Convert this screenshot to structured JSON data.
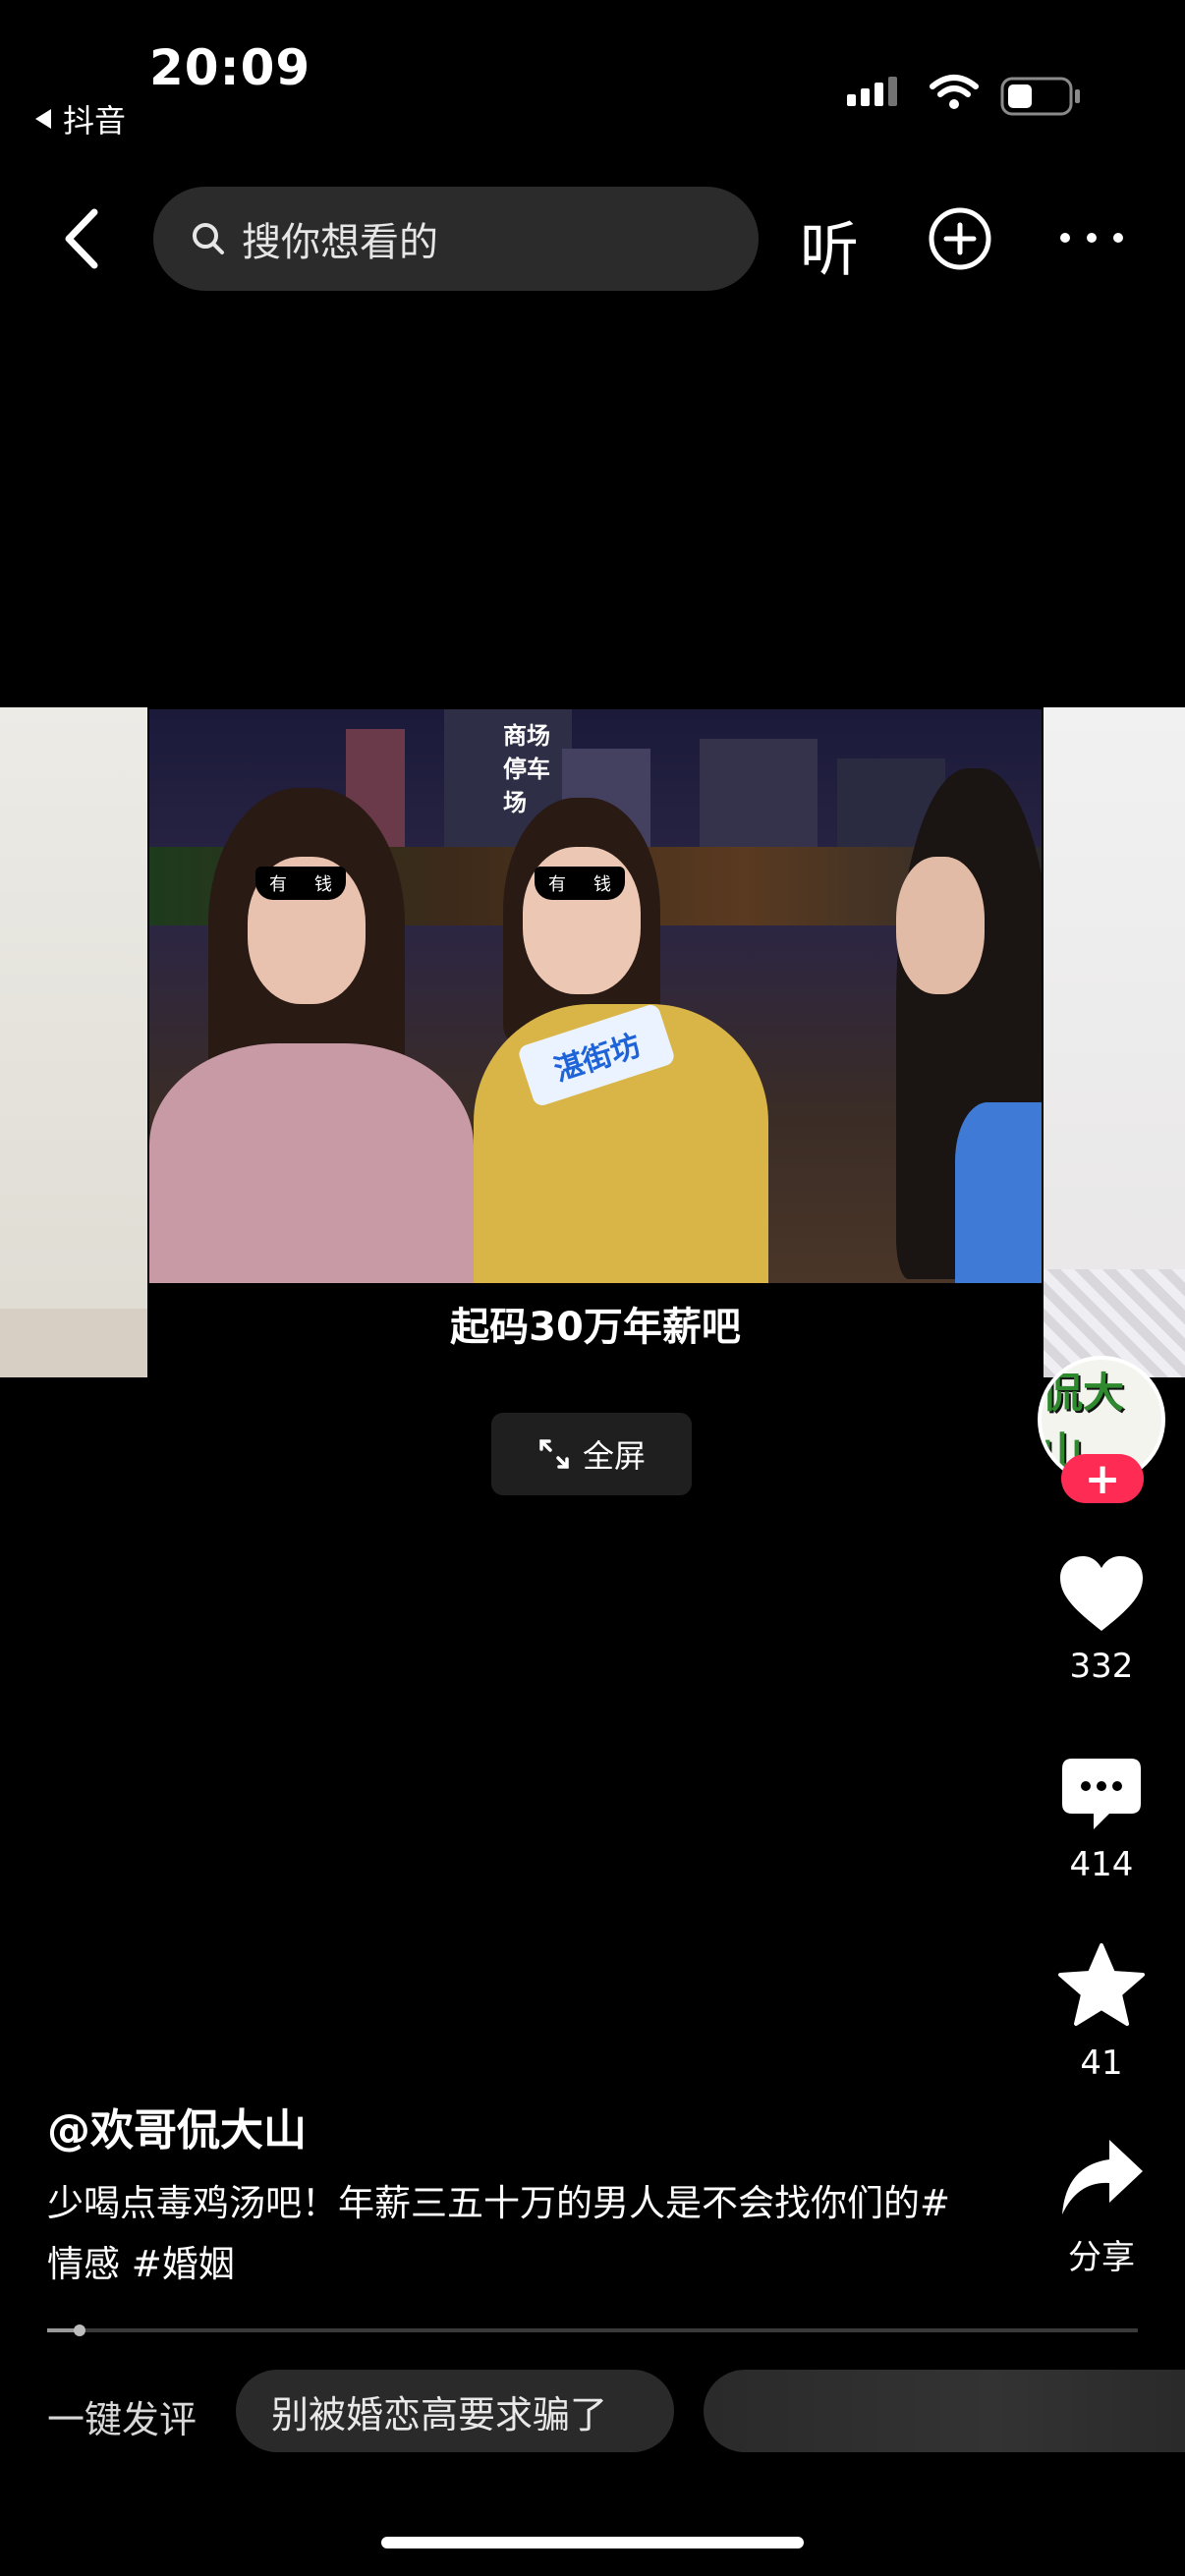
{
  "status": {
    "time": "20:09",
    "back_app": "抖音"
  },
  "nav": {
    "search_placeholder": "搜你想看的",
    "listen_label": "听"
  },
  "video": {
    "glasses_text": [
      "有",
      "钱"
    ],
    "mic_logo": "湛街坊",
    "sign_text": "商场 停车场",
    "caption": "起码30万年薪吧",
    "fullscreen_label": "全屏"
  },
  "actions": {
    "avatar_text": "侃大山",
    "follow_label": "+",
    "likes": "332",
    "comments": "414",
    "favorites": "41",
    "share_label": "分享"
  },
  "post": {
    "author": "@欢哥侃大山",
    "description": "少喝点毒鸡汤吧！年薪三五十万的男人是不会找你们的#情感 #婚姻",
    "progress": 0.03
  },
  "quick_comment": {
    "label": "一键发评",
    "chips": [
      "别被婚恋高要求骗了",
      ""
    ]
  },
  "colors": {
    "accent": "#fe2c55",
    "background": "#000000"
  }
}
